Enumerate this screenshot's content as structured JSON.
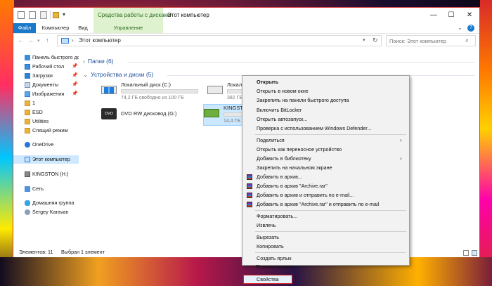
{
  "window": {
    "title": "Этот компьютер",
    "context_tab": "Средства работы с дисками",
    "controls": {
      "minimize": "—",
      "maximize": "☐",
      "close": "✕"
    }
  },
  "ribbon": {
    "file": "Файл",
    "computer": "Компьютер",
    "view": "Вид",
    "manage": "Управление"
  },
  "address": {
    "path": "Этот компьютер",
    "search_placeholder": "Поиск: Этот компьютер"
  },
  "sidebar": {
    "items": [
      {
        "label": "Панель быстрого дос",
        "icon": "star-icon"
      },
      {
        "label": "Рабочий стол",
        "icon": "desktop-icon",
        "pinned": true
      },
      {
        "label": "Загрузки",
        "icon": "download-icon",
        "pinned": true
      },
      {
        "label": "Документы",
        "icon": "documents-icon",
        "pinned": true
      },
      {
        "label": "Изображения",
        "icon": "pictures-icon",
        "pinned": true
      },
      {
        "label": "1",
        "icon": "folder-icon"
      },
      {
        "label": "ESD",
        "icon": "folder-icon"
      },
      {
        "label": "Utilities",
        "icon": "folder-icon"
      },
      {
        "label": "Спящий режим",
        "icon": "folder-icon"
      },
      {
        "label": "OneDrive",
        "icon": "onedrive-icon"
      },
      {
        "label": "Этот компьютер",
        "icon": "computer-icon",
        "selected": true
      },
      {
        "label": "KINGSTON (H:)",
        "icon": "usb-drive-icon"
      },
      {
        "label": "Сеть",
        "icon": "network-icon"
      },
      {
        "label": "Домашняя группа",
        "icon": "homegroup-icon"
      },
      {
        "label": "Sergey Karavan",
        "icon": "user-icon"
      }
    ],
    "pin_glyph": "📌"
  },
  "content": {
    "folders_header": "Папки (6)",
    "devices_header": "Устройства и диски (5)",
    "drives": [
      {
        "name": "Локальный диск (C:)",
        "size": "74,2 ГБ свободно из 100 ГБ",
        "used_fraction": 0.26
      },
      {
        "name": "Локальный",
        "size": "382 ГБ своб",
        "used_fraction": 0.35
      },
      {
        "name": "KINGSTON (",
        "size": "14,4 ГБ своб",
        "used_fraction": 0.05
      },
      {
        "name": "DVD RW дисковод (G:)",
        "icon_text": "DVD"
      }
    ]
  },
  "status": {
    "items_count": "Элементов: 11",
    "selected": "Выбран 1 элемент"
  },
  "context_menu": {
    "items": [
      {
        "label": "Открыть",
        "bold": true
      },
      {
        "label": "Открыть в новом окне"
      },
      {
        "label": "Закрепить на панели быстрого доступа"
      },
      {
        "label": "Включить BitLocker"
      },
      {
        "label": "Открыть автозапуск..."
      },
      {
        "label": "Проверка с использованием Windows Defender..."
      },
      {
        "label": "Поделиться",
        "submenu": true
      },
      {
        "label": "Открыть как переносное устройство"
      },
      {
        "label": "Добавить в библиотеку",
        "submenu": true
      },
      {
        "label": "Закрепить на начальном экране"
      },
      {
        "label": "Добавить в архив...",
        "icon": "winrar-icon"
      },
      {
        "label": "Добавить в архив \"Archive.rar\"",
        "icon": "winrar-icon"
      },
      {
        "label": "Добавить в архив и отправить по e-mail...",
        "icon": "winrar-icon"
      },
      {
        "label": "Добавить в архив \"Archive.rar\" и отправить по e-mail",
        "icon": "winrar-icon"
      },
      {
        "label": "Форматировать..."
      },
      {
        "label": "Извлечь"
      },
      {
        "label": "Вырезать"
      },
      {
        "label": "Копировать"
      },
      {
        "label": "Создать ярлык"
      },
      {
        "label": "Переименовать"
      },
      {
        "label": "Свойства",
        "highlighted": true
      }
    ],
    "submenu_glyph": "›"
  },
  "colors": {
    "accent": "#1979ca",
    "context_tab_bg": "#dff2cf",
    "selection": "#cce8ff",
    "drive_bar": "#26a0da",
    "highlight_border": "#e02020"
  }
}
